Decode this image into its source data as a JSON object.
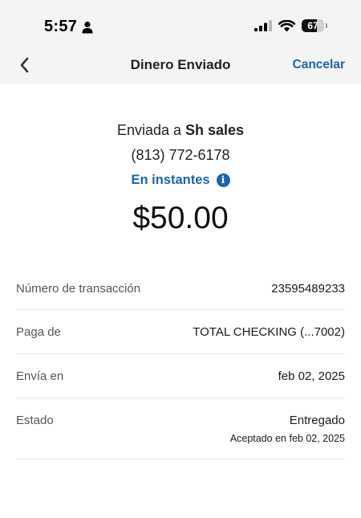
{
  "status_bar": {
    "time": "5:57",
    "battery": "67",
    "battery_level": 0.67,
    "icons": [
      "person-icon",
      "signal-icon",
      "wifi-icon",
      "battery-icon"
    ]
  },
  "nav": {
    "back_icon": "chevron-left-icon",
    "title": "Dinero Enviado",
    "cancel_label": "Cancelar"
  },
  "summary": {
    "sent_prefix": "Enviada a ",
    "recipient": "Sh sales",
    "phone": "(813) 772-6178",
    "speed": "En instantes",
    "info_icon": "info-icon",
    "amount": "$50.00"
  },
  "details": [
    {
      "label": "Número de transacción",
      "value": "23595489233"
    },
    {
      "label": "Paga de",
      "value": "TOTAL CHECKING (...7002)"
    },
    {
      "label": "Envía en",
      "value": "feb 02, 2025"
    },
    {
      "label": "Estado",
      "value": "Entregado",
      "sub": "Aceptado en feb 02, 2025"
    }
  ],
  "colors": {
    "accent": "#1a65b0",
    "header_bg": "#f4f4f4",
    "divider": "#e8e8e8"
  }
}
